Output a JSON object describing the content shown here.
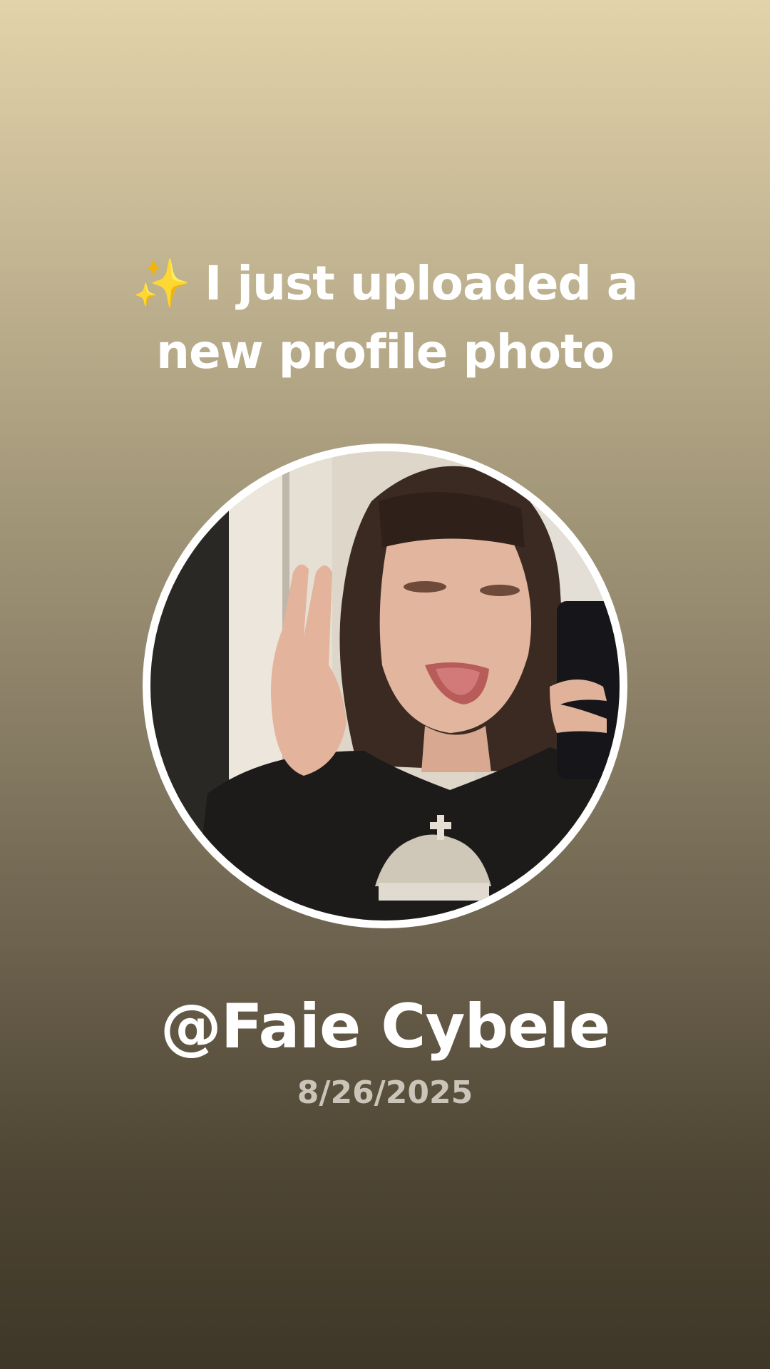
{
  "post": {
    "sparkle_glyph": "✨",
    "headline_line1": "I just uploaded a",
    "headline_line2": "new profile photo",
    "username": "@Faie Cybele",
    "date": "8/26/2025"
  },
  "colors": {
    "background_top": "#e3d3aa",
    "background_bottom": "#3e3627",
    "text": "#ffffff",
    "date_text": "#cbc5b9",
    "avatar_ring": "#ffffff",
    "sparkle": "#f5c62b"
  },
  "avatar": {
    "description_icon": "profile-photo"
  }
}
